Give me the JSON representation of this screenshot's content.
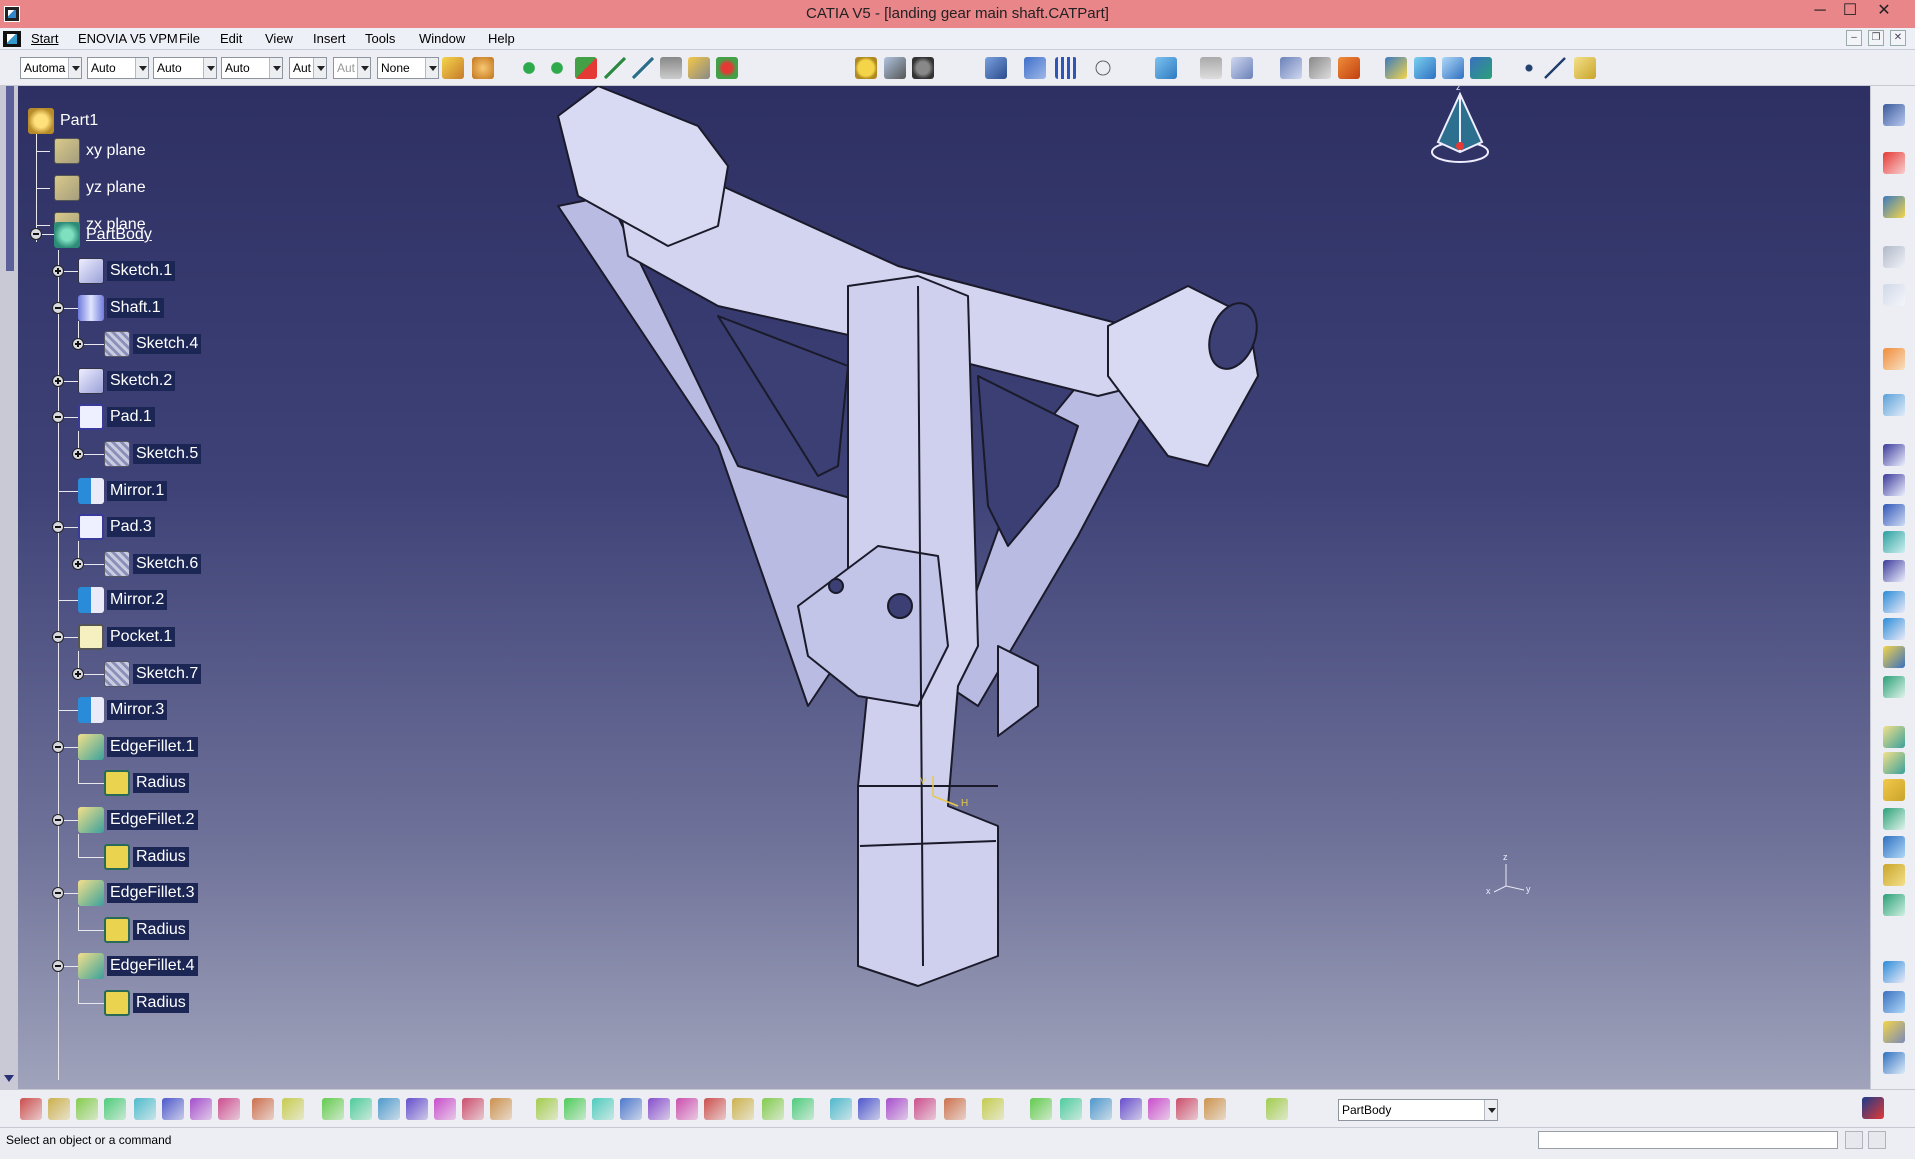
{
  "window": {
    "title": "CATIA V5 - [landing gear main shaft.CATPart]",
    "minimize": "─",
    "maximize": "☐",
    "close": "✕"
  },
  "menu": {
    "items": [
      "Start",
      "ENOVIA V5 VPM",
      "File",
      "Edit",
      "View",
      "Insert",
      "Tools",
      "Window",
      "Help"
    ],
    "doc_minimize": "–",
    "doc_restore": "❐",
    "doc_close": "✕"
  },
  "toolbar": {
    "combos": [
      "Automa",
      "Auto",
      "Auto",
      "Auto",
      "Aut",
      "Aut",
      "None"
    ]
  },
  "tree": {
    "root": "Part1",
    "planes": [
      "xy plane",
      "yz plane",
      "zx plane"
    ],
    "body": "PartBody",
    "nodes": [
      {
        "label": "Sketch.1",
        "icon": "sketch-icon",
        "level": 1,
        "expander": "plus"
      },
      {
        "label": "Shaft.1",
        "icon": "shaft-icon",
        "level": 1,
        "expander": "minus"
      },
      {
        "label": "Sketch.4",
        "icon": "sketch-icon",
        "level": 2,
        "expander": "plus"
      },
      {
        "label": "Sketch.2",
        "icon": "sketch-icon",
        "level": 1,
        "expander": "plus"
      },
      {
        "label": "Pad.1",
        "icon": "pad-icon",
        "level": 1,
        "expander": "minus"
      },
      {
        "label": "Sketch.5",
        "icon": "sketch-icon",
        "level": 2,
        "expander": "plus"
      },
      {
        "label": "Mirror.1",
        "icon": "mirror-icon",
        "level": 1,
        "expander": "none"
      },
      {
        "label": "Pad.3",
        "icon": "pad-icon",
        "level": 1,
        "expander": "minus"
      },
      {
        "label": "Sketch.6",
        "icon": "sketch-icon",
        "level": 2,
        "expander": "plus"
      },
      {
        "label": "Mirror.2",
        "icon": "mirror-icon",
        "level": 1,
        "expander": "none"
      },
      {
        "label": "Pocket.1",
        "icon": "pocket-icon",
        "level": 1,
        "expander": "minus"
      },
      {
        "label": "Sketch.7",
        "icon": "sketch-icon",
        "level": 2,
        "expander": "plus"
      },
      {
        "label": "Mirror.3",
        "icon": "mirror-icon",
        "level": 1,
        "expander": "none"
      },
      {
        "label": "EdgeFillet.1",
        "icon": "fillet-icon",
        "level": 1,
        "expander": "minus"
      },
      {
        "label": "Radius",
        "icon": "radius-icon",
        "level": 2,
        "expander": "none"
      },
      {
        "label": "EdgeFillet.2",
        "icon": "fillet-icon",
        "level": 1,
        "expander": "minus"
      },
      {
        "label": "Radius",
        "icon": "radius-icon",
        "level": 2,
        "expander": "none"
      },
      {
        "label": "EdgeFillet.3",
        "icon": "fillet-icon",
        "level": 1,
        "expander": "minus"
      },
      {
        "label": "Radius",
        "icon": "radius-icon",
        "level": 2,
        "expander": "none"
      },
      {
        "label": "EdgeFillet.4",
        "icon": "fillet-icon",
        "level": 1,
        "expander": "minus"
      },
      {
        "label": "Radius",
        "icon": "radius-icon",
        "level": 2,
        "expander": "none"
      }
    ]
  },
  "viewport": {
    "compass_label": "z",
    "axis_labels": {
      "x": "x",
      "y": "y",
      "z": "z"
    },
    "sketch_axis": {
      "h": "H",
      "v": "V"
    }
  },
  "bottom_toolbar": {
    "current_body": "PartBody"
  },
  "status": {
    "message": "Select an object or a command"
  },
  "colors": {
    "titlebar": "#e9868a",
    "viewport_top": "#2e3063",
    "viewport_bottom": "#a0a3bb",
    "part_face": "#c9cae8",
    "highlight": "#1c2654"
  }
}
